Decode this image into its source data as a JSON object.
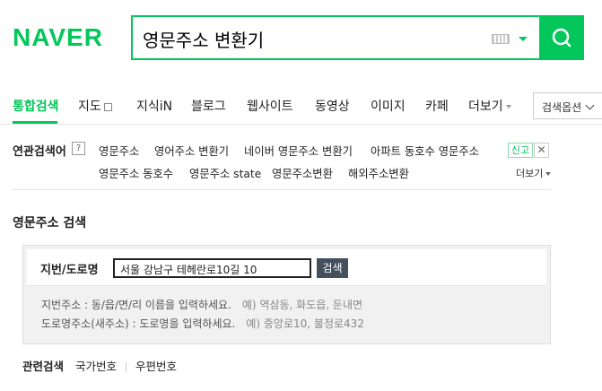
{
  "header": {
    "logo": "NAVER",
    "query": "영문주소 변환기",
    "brand_color": "#03c75a",
    "icons": {
      "keyboard": "keyboard-icon",
      "dropdown": "caret-down-icon",
      "search": "magnifier-icon"
    }
  },
  "tabs": [
    {
      "label": "통합검색",
      "active": true
    },
    {
      "label": "지도",
      "icon": "map-icon"
    },
    {
      "label": "지식iN"
    },
    {
      "label": "블로그"
    },
    {
      "label": "웹사이트"
    },
    {
      "label": "동영상"
    },
    {
      "label": "이미지"
    },
    {
      "label": "카페"
    },
    {
      "label": "더보기",
      "icon": "caret-down-icon"
    }
  ],
  "search_options": "검색옵션",
  "related": {
    "title": "연관검색어",
    "help": "?",
    "row1": [
      "영문주소",
      "영어주소 변환기",
      "네이버 영문주소 변환기",
      "아파트 동호수 영문주소"
    ],
    "row2": [
      "영문주소 동호수",
      "영문주소 state",
      "영문주소변환",
      "해외주소변환"
    ],
    "report": "신고",
    "close": "✕",
    "more": "더보기"
  },
  "converter": {
    "title": "영문주소 검색",
    "label": "지번/도로명",
    "input_value": "서울 강남구 테헤란로10길 10",
    "button": "검색",
    "help": [
      {
        "text": "지번주소 : 동/읍/면/리 이름을 입력하세요.",
        "example": "예) 역삼동, 화도읍, 둔내면"
      },
      {
        "text": "도로명주소(새주소) : 도로명을 입력하세요.",
        "example": "예) 중앙로10, 불정로432"
      }
    ]
  },
  "bottom": {
    "title": "관련검색",
    "links": [
      "국가번호",
      "우편번호"
    ]
  }
}
